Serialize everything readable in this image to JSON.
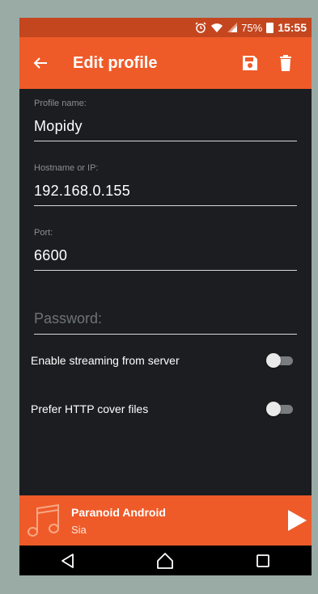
{
  "status_bar": {
    "battery_percent": "75%",
    "time": "15:55",
    "icons": [
      "alarm-icon",
      "wifi-icon",
      "signal-icon",
      "battery-icon"
    ]
  },
  "app_bar": {
    "title": "Edit profile",
    "icons": [
      "back-arrow-icon",
      "save-icon",
      "delete-icon"
    ]
  },
  "form": {
    "profile_name": {
      "label": "Profile name:",
      "value": "Mopidy"
    },
    "hostname": {
      "label": "Hostname or IP:",
      "value": "192.168.0.155"
    },
    "port": {
      "label": "Port:",
      "value": "6600"
    },
    "password": {
      "placeholder": "Password:",
      "value": ""
    }
  },
  "toggles": [
    {
      "label": "Enable streaming from server",
      "enabled": false
    },
    {
      "label": "Prefer HTTP cover files",
      "enabled": false
    }
  ],
  "now_playing": {
    "title": "Paranoid Android",
    "artist": "Sia",
    "icons": [
      "music-note-icon",
      "play-icon"
    ]
  },
  "nav_bar": {
    "icons": [
      "back-icon",
      "home-icon",
      "recents-icon"
    ]
  },
  "colors": {
    "accent": "#ee5b29",
    "status_bar": "#c4461f",
    "background": "#1b1d21",
    "frame": "#9aaba6"
  }
}
